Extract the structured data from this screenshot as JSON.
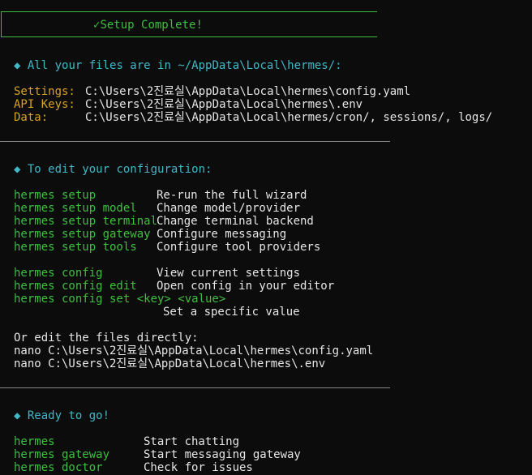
{
  "banner": {
    "check": "✓",
    "text": "Setup Complete!"
  },
  "files": {
    "header_icon": "◆",
    "header": "All your files are in ~/AppData\\Local\\hermes/:",
    "rows": [
      {
        "label": "Settings:",
        "value": "C:\\Users\\2진료실\\AppData\\Local\\hermes\\config.yaml"
      },
      {
        "label": "API Keys:",
        "value": "C:\\Users\\2진료실\\AppData\\Local\\hermes\\.env"
      },
      {
        "label": "Data:",
        "value": "C:\\Users\\2진료실\\AppData\\Local\\hermes/cron/, sessions/, logs/"
      }
    ]
  },
  "edit": {
    "header_icon": "◆",
    "header": "To edit your configuration:",
    "setup_cmds": [
      {
        "cmd": "hermes setup",
        "desc": "Re-run the full wizard"
      },
      {
        "cmd": "hermes setup model",
        "desc": "Change model/provider"
      },
      {
        "cmd": "hermes setup terminal",
        "desc": "Change terminal backend"
      },
      {
        "cmd": "hermes setup gateway",
        "desc": "Configure messaging"
      },
      {
        "cmd": "hermes setup tools",
        "desc": "Configure tool providers"
      }
    ],
    "config_cmds": [
      {
        "cmd": "hermes config",
        "desc": "View current settings"
      },
      {
        "cmd": "hermes config edit",
        "desc": "Open config in your editor"
      }
    ],
    "config_set_cmd": "hermes config set <key> <value>",
    "config_set_desc": "Set a specific value",
    "direct_header": "Or edit the files directly:",
    "direct_lines": [
      "nano C:\\Users\\2진료실\\AppData\\Local\\hermes\\config.yaml",
      "nano C:\\Users\\2진료실\\AppData\\Local\\hermes\\.env"
    ]
  },
  "ready": {
    "header_icon": "◆",
    "header": "Ready to go!",
    "cmds": [
      {
        "cmd": "hermes",
        "desc": "Start chatting"
      },
      {
        "cmd": "hermes gateway",
        "desc": "Start messaging gateway"
      },
      {
        "cmd": "hermes doctor",
        "desc": "Check for issues"
      }
    ]
  },
  "colors": {
    "green": "#3fbf3f",
    "cyan": "#3fb8c8",
    "gold": "#d7a321",
    "background": "#0c0c0c"
  }
}
